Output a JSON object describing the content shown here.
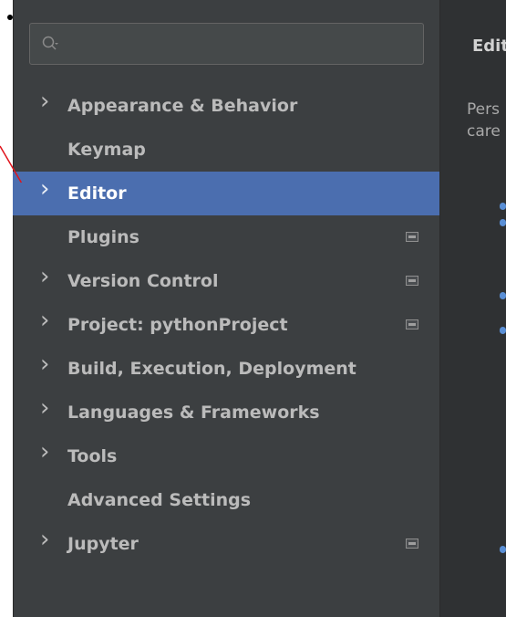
{
  "search": {
    "placeholder": ""
  },
  "sidebar": {
    "items": [
      {
        "label": "Appearance & Behavior",
        "expandable": true,
        "badge": false,
        "selected": false
      },
      {
        "label": "Keymap",
        "expandable": false,
        "badge": false,
        "selected": false
      },
      {
        "label": "Editor",
        "expandable": true,
        "badge": false,
        "selected": true
      },
      {
        "label": "Plugins",
        "expandable": false,
        "badge": true,
        "selected": false
      },
      {
        "label": "Version Control",
        "expandable": true,
        "badge": true,
        "selected": false
      },
      {
        "label": "Project: pythonProject",
        "expandable": true,
        "badge": true,
        "selected": false
      },
      {
        "label": "Build, Execution, Deployment",
        "expandable": true,
        "badge": false,
        "selected": false
      },
      {
        "label": "Languages & Frameworks",
        "expandable": true,
        "badge": false,
        "selected": false
      },
      {
        "label": "Tools",
        "expandable": true,
        "badge": false,
        "selected": false
      },
      {
        "label": "Advanced Settings",
        "expandable": false,
        "badge": false,
        "selected": false
      },
      {
        "label": "Jupyter",
        "expandable": true,
        "badge": true,
        "selected": false
      }
    ]
  },
  "panel": {
    "title": "Edit",
    "description_line1": "Pers",
    "description_line2": "care"
  },
  "colors": {
    "sidebar_bg": "#3c3f41",
    "selected_bg": "#4b6eaf",
    "text": "#bbbbbb",
    "annotation_arrow": "#e0141c"
  }
}
